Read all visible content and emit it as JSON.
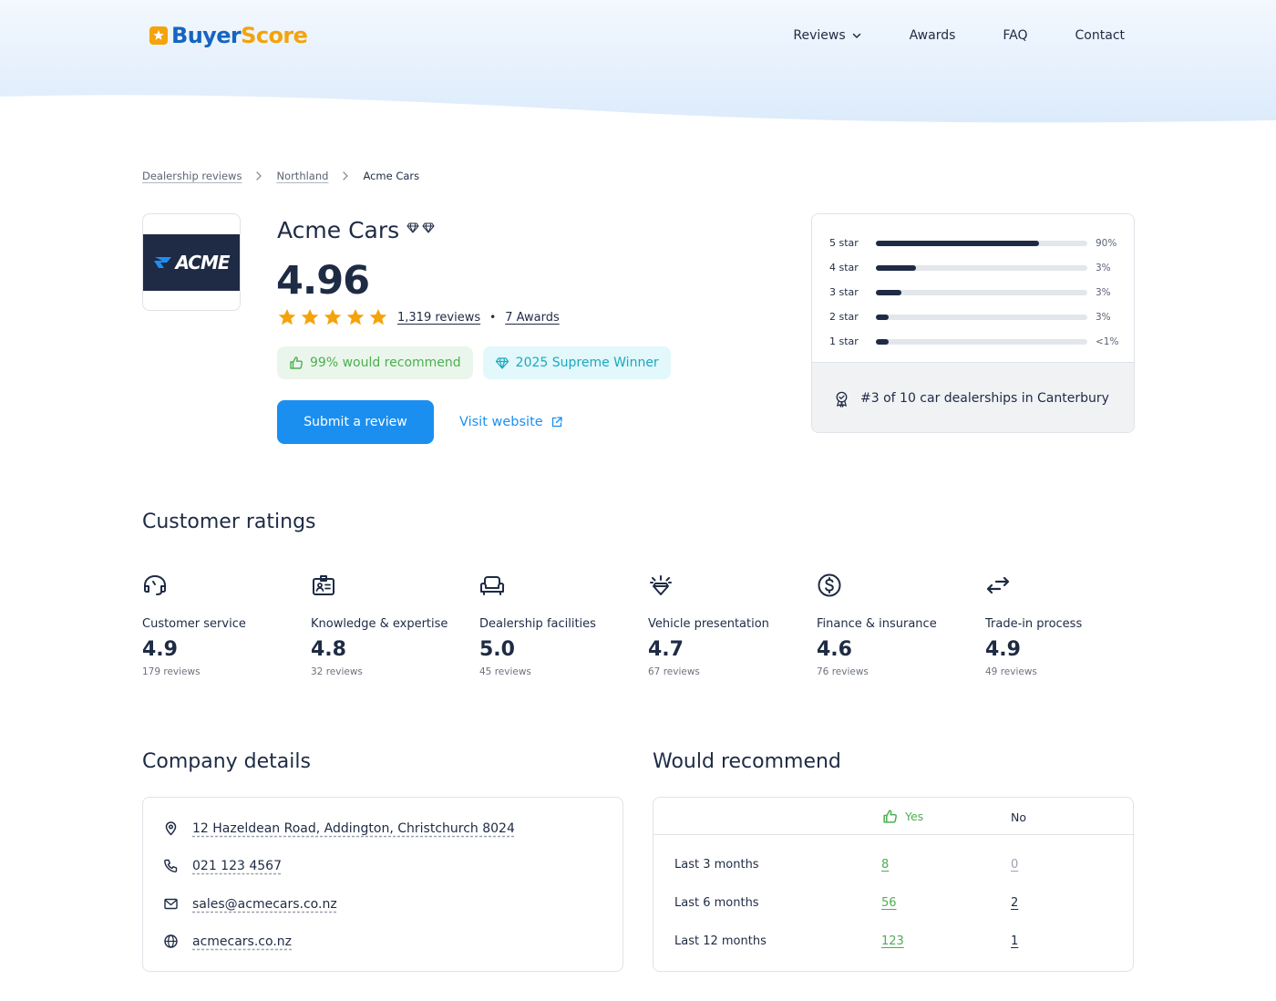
{
  "header": {
    "logo_part1": "Buyer",
    "logo_part2": "Score",
    "nav": [
      {
        "label": "Reviews",
        "icon": "chevron-down-icon"
      },
      {
        "label": "Awards"
      },
      {
        "label": "FAQ"
      },
      {
        "label": "Contact"
      }
    ]
  },
  "breadcrumb": {
    "items": [
      "Dealership reviews",
      "Northland"
    ],
    "current": "Acme Cars"
  },
  "company": {
    "logo_text": "ACME",
    "name": "Acme Cars",
    "score": "4.96",
    "stars": 5,
    "reviews_link": "1,319 reviews",
    "awards_link": "7 Awards",
    "separator": "•",
    "recommend_badge": "99% would recommend",
    "award_badge": "2025 Supreme Winner",
    "submit_label": "Submit a review",
    "visit_label": "Visit website"
  },
  "distribution": {
    "rows": [
      {
        "label": "5 star",
        "pct": "90%",
        "fill": 0.77
      },
      {
        "label": "4 star",
        "pct": "3%",
        "fill": 0.19
      },
      {
        "label": "3 star",
        "pct": "3%",
        "fill": 0.12
      },
      {
        "label": "2 star",
        "pct": "3%",
        "fill": 0.06
      },
      {
        "label": "1 star",
        "pct": "<1%",
        "fill": 0.06
      }
    ],
    "rank_text": "#3 of 10 car dealerships in Canterbury"
  },
  "customer_ratings": {
    "title": "Customer ratings",
    "items": [
      {
        "icon": "headset-icon",
        "name": "Customer service",
        "score": "4.9",
        "count": "179 reviews"
      },
      {
        "icon": "id-badge-icon",
        "name": "Knowledge & expertise",
        "score": "4.8",
        "count": "32 reviews"
      },
      {
        "icon": "armchair-icon",
        "name": "Dealership facilities",
        "score": "5.0",
        "count": "45 reviews"
      },
      {
        "icon": "sparkle-diamond-icon",
        "name": "Vehicle presentation",
        "score": "4.7",
        "count": "67 reviews"
      },
      {
        "icon": "dollar-circle-icon",
        "name": "Finance & insurance",
        "score": "4.6",
        "count": "76 reviews"
      },
      {
        "icon": "swap-arrows-icon",
        "name": "Trade-in process",
        "score": "4.9",
        "count": "49 reviews"
      }
    ]
  },
  "company_details": {
    "title": "Company details",
    "address": "12 Hazeldean Road, Addington, Christchurch 8024",
    "phone": "021 123 4567",
    "email": "sales@acmecars.co.nz",
    "website": "acmecars.co.nz"
  },
  "would_recommend": {
    "title": "Would recommend",
    "yes_label": "Yes",
    "no_label": "No",
    "rows": [
      {
        "period": "Last 3 months",
        "yes": "8",
        "no": "0"
      },
      {
        "period": "Last 6 months",
        "yes": "56",
        "no": "2"
      },
      {
        "period": "Last 12 months",
        "yes": "123",
        "no": "1"
      }
    ]
  },
  "colors": {
    "primary": "#1b8ff0",
    "navy": "#1f2a44",
    "star": "#f5a30a",
    "green": "#4caf50",
    "teal": "#1aa9c0"
  }
}
